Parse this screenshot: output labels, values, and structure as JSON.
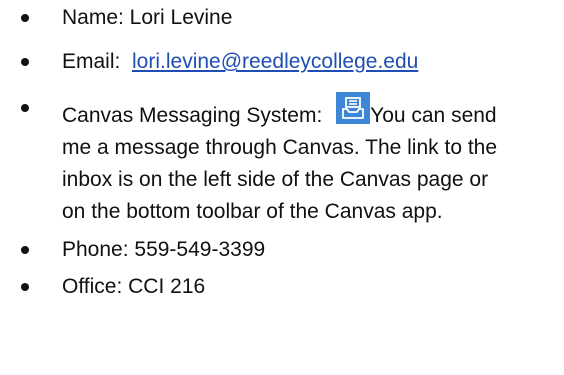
{
  "contact": {
    "name_text": "Name:  Lori Levine",
    "email_label": "Email:  ",
    "email_link": "lori.levine@reedleycollege.edu",
    "canvas_label": "Canvas Messaging System: ",
    "canvas_icon": "canvas-inbox-icon",
    "canvas_text": "You can send me a message through Canvas.  The link to the inbox is on the left side of the Canvas page or on the bottom toolbar of the Canvas app.",
    "phone_text": "Phone: 559-549-3399",
    "office_text": "Office:  CCI 216"
  },
  "colors": {
    "link": "#1f4fb4",
    "icon_bg": "#3e86d8"
  }
}
